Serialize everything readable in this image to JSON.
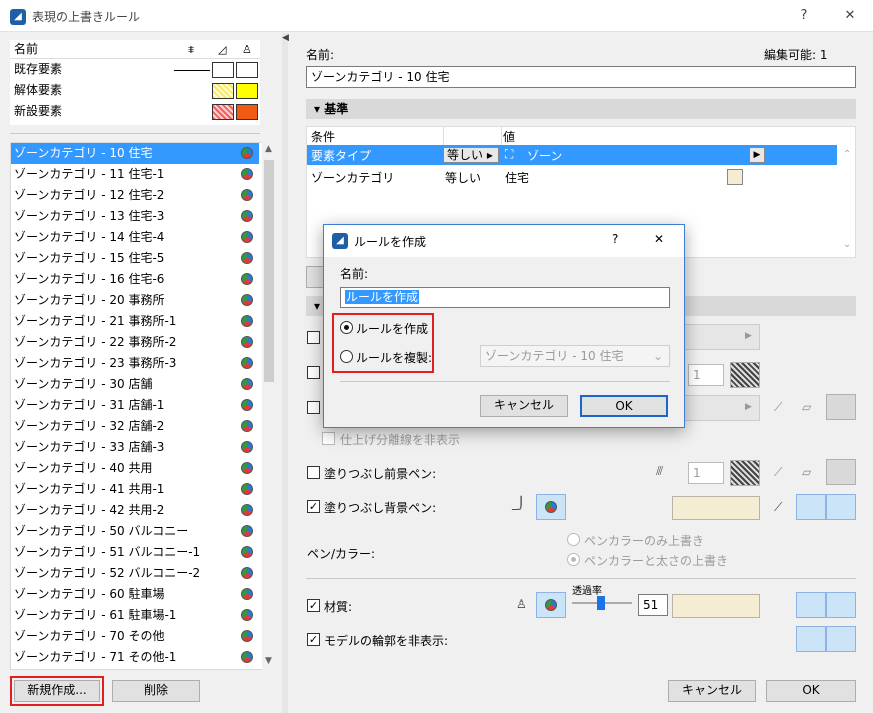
{
  "window": {
    "title": "表現の上書きルール",
    "help": "?",
    "close": "✕"
  },
  "legend": {
    "header": "名前",
    "rows": [
      {
        "label": "既存要素"
      },
      {
        "label": "解体要素"
      },
      {
        "label": "新設要素"
      }
    ],
    "colors": {
      "demolish": "#ffff00",
      "demolish_hatch": "#f7e96a",
      "new": "#f05a14",
      "new_hatch": "#f26060"
    }
  },
  "rule_list": {
    "items": [
      "ゾーンカテゴリ - 10 住宅",
      "ゾーンカテゴリ - 11 住宅-1",
      "ゾーンカテゴリ - 12 住宅-2",
      "ゾーンカテゴリ - 13 住宅-3",
      "ゾーンカテゴリ - 14 住宅-4",
      "ゾーンカテゴリ - 15 住宅-5",
      "ゾーンカテゴリ - 16 住宅-6",
      "ゾーンカテゴリ - 20 事務所",
      "ゾーンカテゴリ - 21 事務所-1",
      "ゾーンカテゴリ - 22 事務所-2",
      "ゾーンカテゴリ - 23 事務所-3",
      "ゾーンカテゴリ - 30 店舗",
      "ゾーンカテゴリ - 31 店舗-1",
      "ゾーンカテゴリ - 32 店舗-2",
      "ゾーンカテゴリ - 33 店舗-3",
      "ゾーンカテゴリ - 40 共用",
      "ゾーンカテゴリ - 41 共用-1",
      "ゾーンカテゴリ - 42 共用-2",
      "ゾーンカテゴリ - 50 バルコニー",
      "ゾーンカテゴリ - 51 バルコニー-1",
      "ゾーンカテゴリ - 52 バルコニー-2",
      "ゾーンカテゴリ - 60 駐車場",
      "ゾーンカテゴリ - 61 駐車場-1",
      "ゾーンカテゴリ - 70 その他",
      "ゾーンカテゴリ - 71 その他-1"
    ],
    "selected_index": 0,
    "new_button": "新規作成...",
    "delete_button": "削除"
  },
  "details": {
    "name_label": "名前:",
    "editable": "編集可能: 1",
    "name_value": "ゾーンカテゴリ - 10 住宅",
    "criteria_section": "基準",
    "criteria_headers": {
      "condition": "条件",
      "value": "値"
    },
    "criteria_rows": [
      {
        "condition": "要素タイプ",
        "operator": "等しい",
        "value": "ゾーン"
      },
      {
        "condition": "ゾーンカテゴリ",
        "operator": "等しい",
        "value": "住宅"
      }
    ],
    "finish_sep": "仕上げ分離線を非表示",
    "fill_fg_pen": "塗りつぶし前景ペン:",
    "fill_fg_value": "1",
    "fill_bg_pen": "塗りつぶし背景ペン:",
    "pen_color_label": "ペン/カラー:",
    "pen_opt1": "ペンカラーのみ上書き",
    "pen_opt2": "ペンカラーと太さの上書き",
    "material_label": "材質:",
    "transparency_label": "透過率",
    "transparency_value": "51",
    "hide_outline": "モデルの輪郭を非表示:",
    "pen_value": "1",
    "cancel_button": "キャンセル",
    "ok_button": "OK"
  },
  "dialog": {
    "title": "ルールを作成",
    "help": "?",
    "close": "✕",
    "name_label": "名前:",
    "name_value": "ルールを作成",
    "opt_create": "ルールを作成",
    "opt_duplicate": "ルールを複製:",
    "duplicate_source": "ゾーンカテゴリ - 10 住宅",
    "cancel_button": "キャンセル",
    "ok_button": "OK"
  }
}
